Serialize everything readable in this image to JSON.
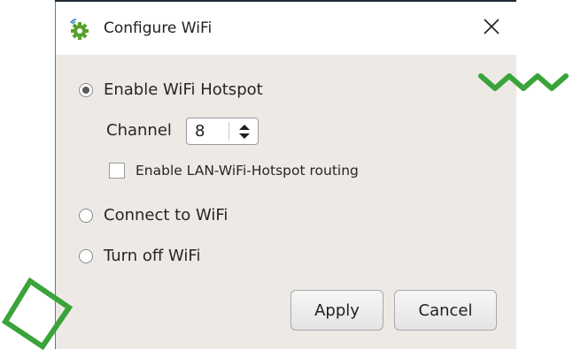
{
  "window": {
    "title": "Configure WiFi",
    "app_icon": "gear-wifi-icon",
    "close_icon": "close-icon"
  },
  "options": [
    {
      "label": "Enable WiFi Hotspot",
      "checked": true
    },
    {
      "label": "Connect to WiFi",
      "checked": false
    },
    {
      "label": "Turn off WiFi",
      "checked": false
    }
  ],
  "hotspot": {
    "channel_label": "Channel",
    "channel_value": "8",
    "routing_label": "Enable LAN-WiFi-Hotspot routing",
    "routing_checked": false
  },
  "buttons": {
    "apply": "Apply",
    "cancel": "Cancel"
  },
  "colors": {
    "accent_overlay": "#3aa33a",
    "window_border": "#3d7fc9",
    "dialog_background": "#edeae6"
  }
}
